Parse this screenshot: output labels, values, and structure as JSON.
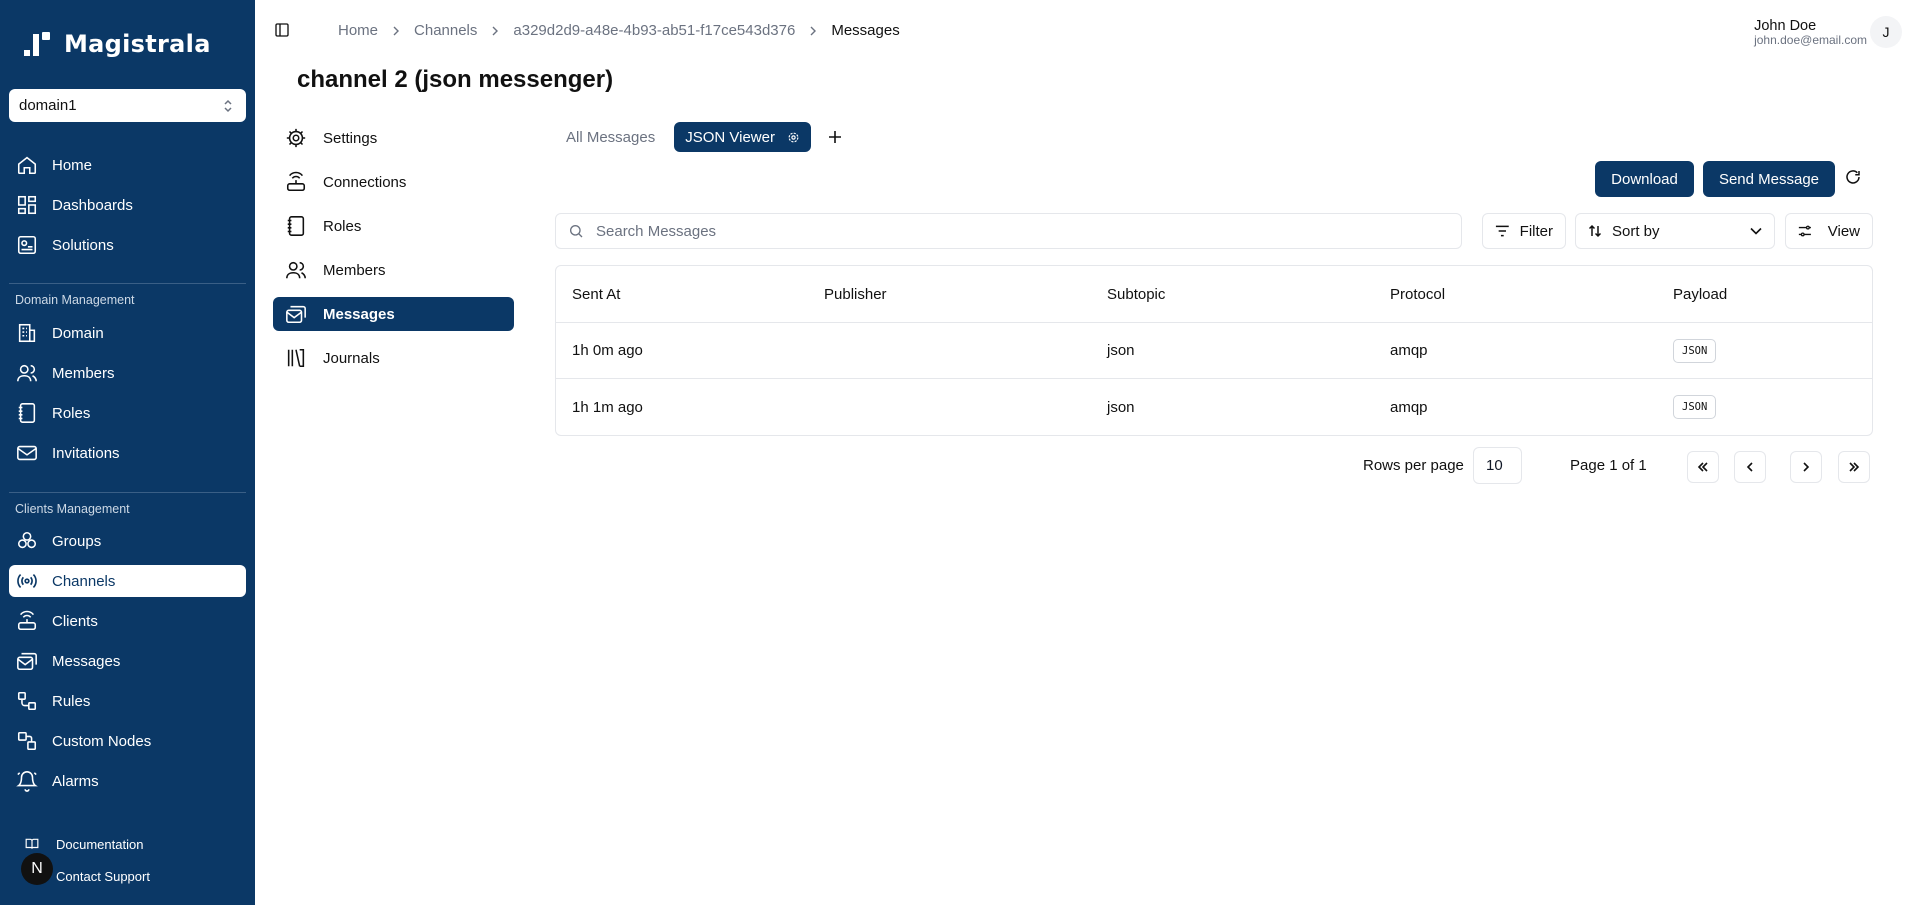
{
  "app": {
    "name": "Magistrala"
  },
  "domain_select": {
    "value": "domain1"
  },
  "sidebar": {
    "main": [
      {
        "label": "Home",
        "icon": "home-icon"
      },
      {
        "label": "Dashboards",
        "icon": "dashboard-icon"
      },
      {
        "label": "Solutions",
        "icon": "solutions-icon"
      }
    ],
    "domain_section": "Domain Management",
    "domain_items": [
      {
        "label": "Domain",
        "icon": "building-icon"
      },
      {
        "label": "Members",
        "icon": "users-icon"
      },
      {
        "label": "Roles",
        "icon": "notebook-icon"
      },
      {
        "label": "Invitations",
        "icon": "mail-icon"
      }
    ],
    "clients_section": "Clients Management",
    "clients_items": [
      {
        "label": "Groups",
        "icon": "groups-icon"
      },
      {
        "label": "Channels",
        "icon": "radio-icon",
        "active": true
      },
      {
        "label": "Clients",
        "icon": "router-icon"
      },
      {
        "label": "Messages",
        "icon": "inbox-icon"
      },
      {
        "label": "Rules",
        "icon": "workflow-icon"
      },
      {
        "label": "Custom Nodes",
        "icon": "nodes-icon"
      },
      {
        "label": "Alarms",
        "icon": "bell-icon"
      }
    ],
    "footer": {
      "documentation": "Documentation",
      "support": "Contact Support",
      "badge": "N"
    }
  },
  "breadcrumb": [
    "Home",
    "Channels",
    "a329d2d9-a48e-4b93-ab51-f17ce543d376",
    "Messages"
  ],
  "user": {
    "name": "John Doe",
    "email": "john.doe@email.com",
    "initial": "J"
  },
  "page": {
    "title": "channel 2 (json messenger)"
  },
  "subnav": [
    {
      "label": "Settings",
      "icon": "gear-icon"
    },
    {
      "label": "Connections",
      "icon": "router-icon"
    },
    {
      "label": "Roles",
      "icon": "notebook-icon"
    },
    {
      "label": "Members",
      "icon": "users-icon"
    },
    {
      "label": "Messages",
      "icon": "inbox-icon",
      "active": true
    },
    {
      "label": "Journals",
      "icon": "library-icon"
    }
  ],
  "tabs": {
    "all": "All Messages",
    "json": "JSON Viewer"
  },
  "actions": {
    "download": "Download",
    "send": "Send Message"
  },
  "search": {
    "placeholder": "Search Messages"
  },
  "controls": {
    "filter": "Filter",
    "sort": "Sort by",
    "view": "View"
  },
  "table": {
    "headers": [
      "Sent At",
      "Publisher",
      "Subtopic",
      "Protocol",
      "Payload"
    ],
    "rows": [
      {
        "sent_at": "1h 0m ago",
        "publisher": "",
        "subtopic": "json",
        "protocol": "amqp",
        "payload": "JSON"
      },
      {
        "sent_at": "1h 1m ago",
        "publisher": "",
        "subtopic": "json",
        "protocol": "amqp",
        "payload": "JSON"
      }
    ]
  },
  "pagination": {
    "rows_label": "Rows per page",
    "rows_value": "10",
    "page_label": "Page 1 of 1"
  }
}
